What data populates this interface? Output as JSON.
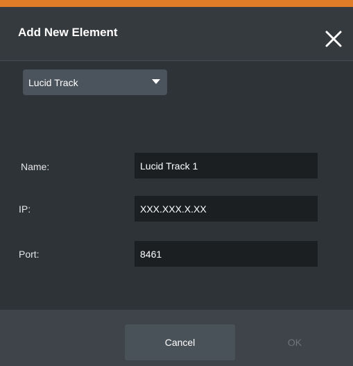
{
  "dialog": {
    "title": "Add New Element",
    "close_icon": "close-icon",
    "accent_color": "#e07b28"
  },
  "type_select": {
    "value": "Lucid Track",
    "caret_icon": "caret-down-icon"
  },
  "fields": {
    "name": {
      "label": "Name:",
      "value": "Lucid Track 1"
    },
    "ip": {
      "label": "IP:",
      "value": "XXX.XXX.X.XX"
    },
    "port": {
      "label": "Port:",
      "value": "8461"
    }
  },
  "footer": {
    "cancel_label": "Cancel",
    "ok_label": "OK",
    "ok_enabled": false
  }
}
